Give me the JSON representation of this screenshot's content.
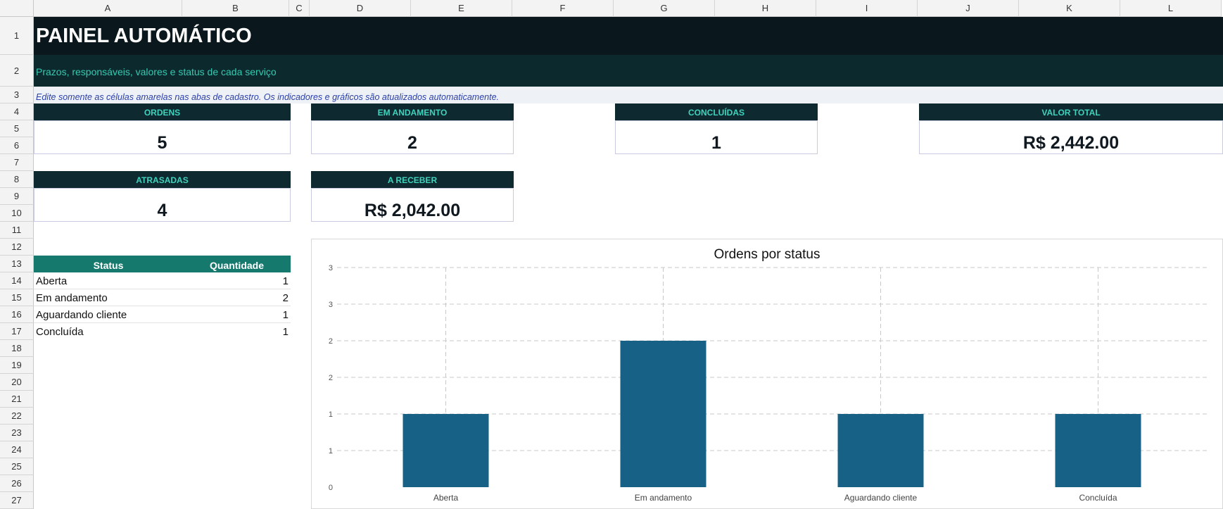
{
  "columns": [
    "A",
    "B",
    "C",
    "D",
    "E",
    "F",
    "G",
    "H",
    "I",
    "J",
    "K",
    "L"
  ],
  "rows": [
    "1",
    "2",
    "3",
    "4",
    "5",
    "6",
    "7",
    "8",
    "9",
    "10",
    "11",
    "12",
    "13",
    "14",
    "15",
    "16",
    "17",
    "18",
    "19",
    "20",
    "21",
    "22",
    "23",
    "24",
    "25",
    "26",
    "27"
  ],
  "header": {
    "title": "PAINEL AUTOMÁTICO",
    "subtitle": "Prazos, responsáveis, valores e status de cada serviço",
    "note": "Edite somente as células amarelas nas abas de cadastro. Os indicadores e gráficos são atualizados automaticamente."
  },
  "kpis": {
    "ordens": {
      "label": "ORDENS",
      "value": "5"
    },
    "em_andamento": {
      "label": "EM ANDAMENTO",
      "value": "2"
    },
    "concluidas": {
      "label": "CONCLUÍDAS",
      "value": "1"
    },
    "valor_total": {
      "label": "VALOR TOTAL",
      "value": "R$ 2,442.00"
    },
    "atrasadas": {
      "label": "ATRASADAS",
      "value": "4"
    },
    "a_receber": {
      "label": "A RECEBER",
      "value": "R$ 2,042.00"
    }
  },
  "status_table": {
    "headers": [
      "Status",
      "Quantidade"
    ],
    "rows": [
      {
        "status": "Aberta",
        "qty": "1"
      },
      {
        "status": "Em andamento",
        "qty": "2"
      },
      {
        "status": "Aguardando cliente",
        "qty": "1"
      },
      {
        "status": "Concluída",
        "qty": "1"
      }
    ]
  },
  "colors": {
    "title_bg": "#0a171d",
    "subtitle_bg": "#0c2a2e",
    "note_bg": "#eef2f7",
    "kpi_header_bg": "#0e2a30",
    "kpi_header_text": "#3fd3bd",
    "table_header_bg": "#15796e",
    "bar": "#166185"
  },
  "chart_data": {
    "type": "bar",
    "title": "Ordens por status",
    "categories": [
      "Aberta",
      "Em andamento",
      "Aguardando cliente",
      "Concluída"
    ],
    "values": [
      1,
      2,
      1,
      1
    ],
    "ylim": [
      0,
      3
    ],
    "ytick_labels": [
      "0",
      "1",
      "1",
      "2",
      "2",
      "3",
      "3"
    ],
    "grid": true
  }
}
